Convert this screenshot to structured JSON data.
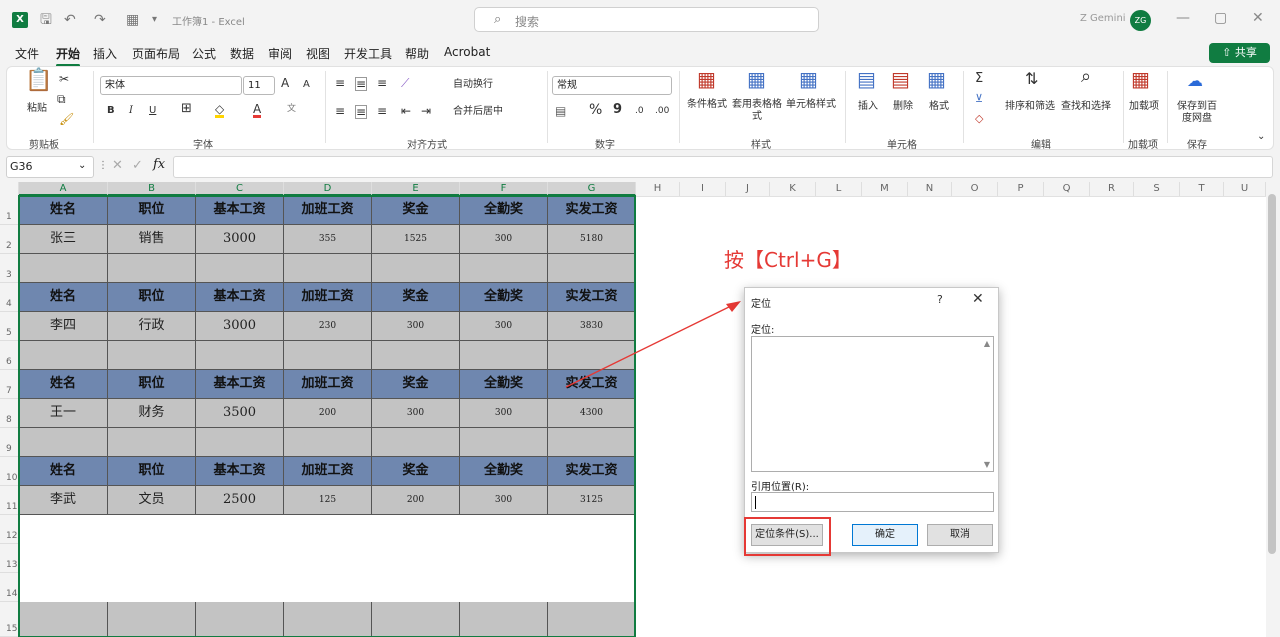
{
  "titlebar": {
    "doc_title": "工作簿1 - Excel",
    "search_placeholder": "搜索",
    "user_name": "Z Gemini",
    "avatar_initials": "ZG"
  },
  "menu": [
    "文件",
    "开始",
    "插入",
    "页面布局",
    "公式",
    "数据",
    "审阅",
    "视图",
    "开发工具",
    "帮助",
    "Acrobat"
  ],
  "share_label": "共享",
  "ribbon": {
    "clipboard": {
      "paste": "粘贴",
      "label": "剪贴板"
    },
    "font": {
      "name": "宋体",
      "size": "11",
      "label": "字体",
      "bold": "B",
      "italic": "I",
      "underline": "U",
      "grow": "A",
      "shrink": "A"
    },
    "alignment": {
      "wrap": "自动换行",
      "merge": "合并后居中",
      "label": "对齐方式"
    },
    "number": {
      "format": "常规",
      "percent": "%",
      "comma": "9",
      "label": "数字"
    },
    "styles": {
      "cond": "条件格式",
      "table": "套用表格格式",
      "cell": "单元格样式",
      "label": "样式"
    },
    "cells": {
      "insert": "插入",
      "delete": "删除",
      "format": "格式",
      "label": "单元格"
    },
    "editing": {
      "sort": "排序和筛选",
      "find": "查找和选择",
      "label": "编辑"
    },
    "addins": {
      "add": "加载项",
      "label": "加载项"
    },
    "save": {
      "save_to": "保存到百度网盘",
      "label": "保存"
    }
  },
  "formula": {
    "name_box": "G36",
    "fx": "fx"
  },
  "columns": [
    "A",
    "B",
    "C",
    "D",
    "E",
    "F",
    "G",
    "H",
    "I",
    "J",
    "K",
    "L",
    "M",
    "N",
    "O",
    "P",
    "Q",
    "R",
    "S",
    "T",
    "U"
  ],
  "rows": [
    "1",
    "2",
    "3",
    "4",
    "5",
    "6",
    "7",
    "8",
    "9",
    "10",
    "11",
    "12",
    "13",
    "14",
    "15"
  ],
  "table_header": [
    "姓名",
    "职位",
    "基本工资",
    "加班工资",
    "奖金",
    "全勤奖",
    "实发工资"
  ],
  "records": [
    [
      "张三",
      "销售",
      "3000",
      "355",
      "1525",
      "300",
      "5180"
    ],
    [
      "李四",
      "行政",
      "3000",
      "230",
      "300",
      "300",
      "3830"
    ],
    [
      "王一",
      "财务",
      "3500",
      "200",
      "300",
      "300",
      "4300"
    ],
    [
      "李武",
      "文员",
      "2500",
      "125",
      "200",
      "300",
      "3125"
    ]
  ],
  "annotation": "按【Ctrl+G】",
  "dialog": {
    "title": "定位",
    "help": "?",
    "close": "✕",
    "goto_label": "定位:",
    "ref_label": "引用位置(R):",
    "special_button": "定位条件(S)...",
    "ok_button": "确定",
    "cancel_button": "取消"
  },
  "colors": {
    "accent": "#107c41",
    "header_fill": "#6f87af",
    "data_fill": "#c3c3c3",
    "annotation": "#e53935"
  }
}
